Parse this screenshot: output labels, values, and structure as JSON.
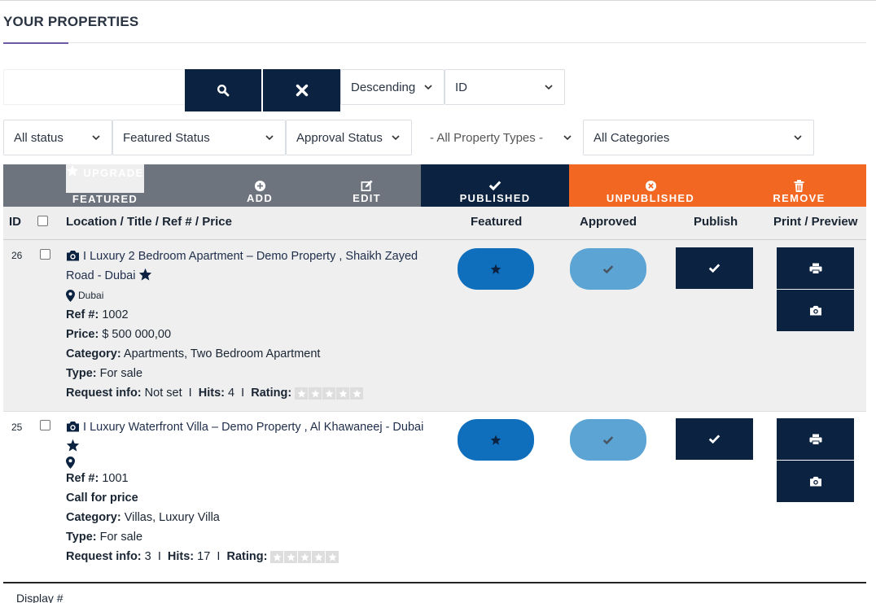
{
  "page": {
    "title": "YOUR PROPERTIES"
  },
  "search": {
    "value": "",
    "placeholder": ""
  },
  "sort": {
    "order": "Descending",
    "field": "ID"
  },
  "filters": {
    "status": "All status",
    "featured": "Featured Status",
    "approval": "Approval Status",
    "property_types": "- All Property Types -",
    "categories": "All Categories"
  },
  "toolbar": {
    "upgrade_line1": "UPGRADE",
    "upgrade_line2": "FEATURED",
    "add": "ADD",
    "edit": "EDIT",
    "published": "PUBLISHED",
    "unpublished": "UNPUBLISHED",
    "remove": "REMOVE"
  },
  "table": {
    "headers": {
      "id": "ID",
      "location": "Location / Title / Ref # / Price",
      "featured": "Featured",
      "approved": "Approved",
      "publish": "Publish",
      "print": "Print / Preview"
    },
    "labels": {
      "ref": "Ref #:",
      "price": "Price:",
      "category": "Category:",
      "type": "Type:",
      "request": "Request info:",
      "hits": "Hits:",
      "rating": "Rating:",
      "sep": "I",
      "title_prefix": "I"
    },
    "rows": [
      {
        "id": "26",
        "title_line1": "Luxury 2 Bedroom Apartment – Demo Property , Shaikh Zayed",
        "title_line2": "Road - Dubai",
        "location": "Dubai",
        "ref": "1002",
        "price": "$ 500 000,00",
        "category": "Apartments, Two Bedroom Apartment",
        "type": "For sale",
        "request_info": "Not set",
        "hits": "4",
        "rating": 0
      },
      {
        "id": "25",
        "title_line1": "Luxury Waterfront Villa – Demo Property , Al Khawaneej - Dubai",
        "location": "",
        "ref": "1001",
        "price_text": "Call for price",
        "category": "Villas, Luxury Villa",
        "type": "For sale",
        "request_info": "3",
        "hits": "17",
        "rating": 0
      }
    ]
  },
  "footer": {
    "display_label": "Display #"
  },
  "colors": {
    "navy": "#0b2340",
    "grey": "#6e747d",
    "orange": "#f26722",
    "featured_blue": "#0f6fbd",
    "approved_blue": "#5ba4d4"
  },
  "icons": [
    "search-icon",
    "close-icon",
    "chevron-down-icon",
    "star-icon",
    "plus-circle-icon",
    "edit-icon",
    "check-icon",
    "x-circle-icon",
    "trash-icon",
    "camera-icon",
    "map-marker-icon",
    "print-icon"
  ]
}
